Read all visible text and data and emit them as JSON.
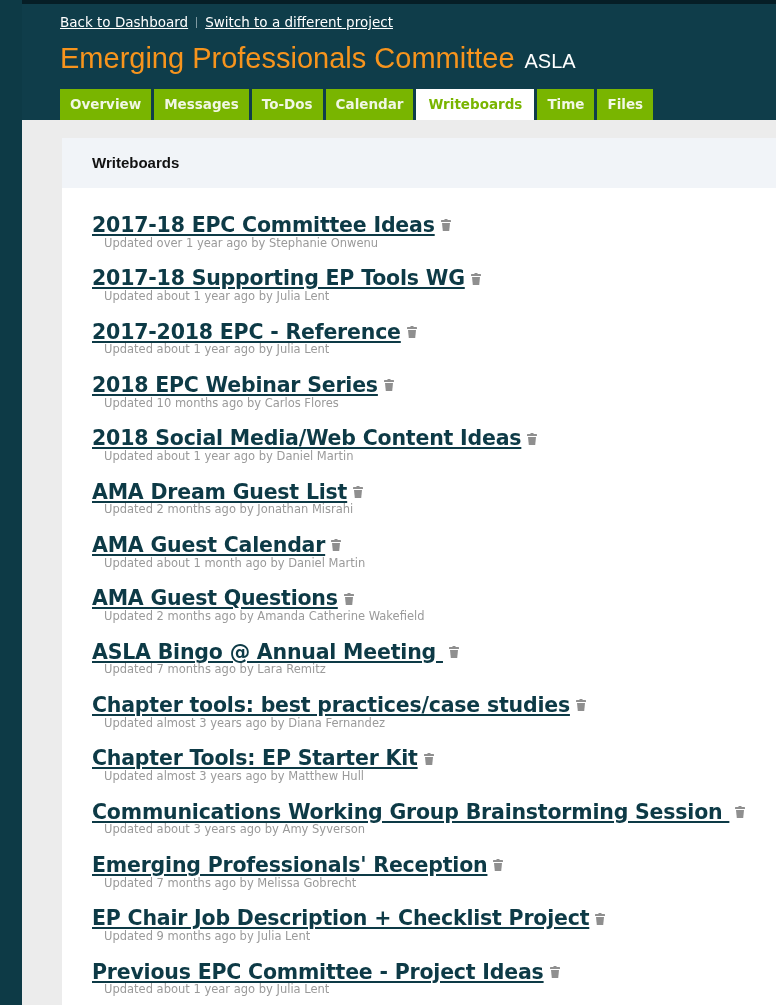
{
  "top_links": [
    "Back to Dashboard",
    "Switch to a different project"
  ],
  "project": {
    "title": "Emerging Professionals Committee",
    "company": "ASLA"
  },
  "tabs": [
    {
      "label": "Overview",
      "selected": false
    },
    {
      "label": "Messages",
      "selected": false
    },
    {
      "label": "To-Dos",
      "selected": false
    },
    {
      "label": "Calendar",
      "selected": false
    },
    {
      "label": "Writeboards",
      "selected": true
    },
    {
      "label": "Time",
      "selected": false
    },
    {
      "label": "Files",
      "selected": false
    }
  ],
  "panel": {
    "title": "Writeboards"
  },
  "writeboards": [
    {
      "title": "2017-18 EPC Committee Ideas",
      "updated": "Updated over 1 year ago by Stephanie Onwenu"
    },
    {
      "title": "2017-18 Supporting EP Tools WG",
      "updated": "Updated about 1 year ago by Julia Lent"
    },
    {
      "title": "2017-2018 EPC - Reference",
      "updated": "Updated about 1 year ago by Julia Lent"
    },
    {
      "title": "2018 EPC Webinar Series",
      "updated": "Updated 10 months ago by Carlos Flores"
    },
    {
      "title": "2018 Social Media/Web Content Ideas",
      "updated": "Updated about 1 year ago by Daniel Martin"
    },
    {
      "title": "AMA Dream Guest List",
      "updated": "Updated 2 months ago by Jonathan Misrahi"
    },
    {
      "title": "AMA Guest Calendar",
      "updated": "Updated about 1 month ago by Daniel Martin"
    },
    {
      "title": "AMA Guest Questions",
      "updated": "Updated 2 months ago by Amanda Catherine Wakefield"
    },
    {
      "title": "ASLA Bingo @ Annual Meeting ",
      "updated": "Updated 7 months ago by Lara Remitz"
    },
    {
      "title": "Chapter tools: best practices/case studies",
      "updated": "Updated almost 3 years ago by Diana Fernandez"
    },
    {
      "title": "Chapter Tools: EP Starter Kit",
      "updated": "Updated almost 3 years ago by Matthew Hull"
    },
    {
      "title": "Communications Working Group Brainstorming Session ",
      "updated": "Updated about 3 years ago by Amy Syverson"
    },
    {
      "title": "Emerging Professionals' Reception",
      "updated": "Updated 7 months ago by Melissa Gobrecht"
    },
    {
      "title": "EP Chair Job Description + Checklist Project",
      "updated": "Updated 9 months ago by Julia Lent"
    },
    {
      "title": "Previous EPC Committee - Project Ideas",
      "updated": "Updated about 1 year ago by Julia Lent"
    }
  ]
}
